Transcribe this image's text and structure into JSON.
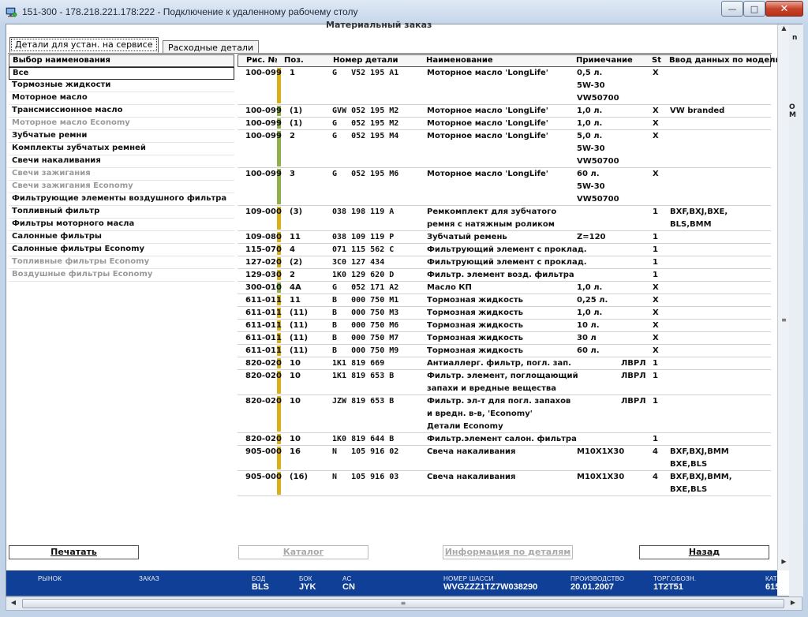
{
  "window": {
    "title": "151-300 - 178.218.221.178:222 - Подключение к удаленному рабочему столу",
    "header_cut": "Материальный заказ"
  },
  "tabs": [
    {
      "label": "Детали для устан. на сервисе"
    },
    {
      "label": "Расходные детали"
    }
  ],
  "list": {
    "header": "Выбор наименования",
    "items": [
      {
        "label": "Все",
        "state": "selected"
      },
      {
        "label": "Тормозные жидкости",
        "state": "normal"
      },
      {
        "label": "Моторное масло",
        "state": "normal"
      },
      {
        "label": "Трансмиссионное масло",
        "state": "normal"
      },
      {
        "label": "Моторное масло Economy",
        "state": "dim"
      },
      {
        "label": "Зубчатые ремни",
        "state": "normal"
      },
      {
        "label": "Комплекты зубчатых ремней",
        "state": "normal"
      },
      {
        "label": "Свечи накаливания",
        "state": "normal"
      },
      {
        "label": "Свечи зажигания",
        "state": "dim"
      },
      {
        "label": "Свечи зажигания Economy",
        "state": "dim"
      },
      {
        "label": "Фильтрующие элементы воздушного фильтра",
        "state": "normal"
      },
      {
        "label": "Топливный фильтр",
        "state": "normal"
      },
      {
        "label": "Фильтры моторного масла",
        "state": "normal"
      },
      {
        "label": "Салонные фильтры",
        "state": "normal"
      },
      {
        "label": "Салонные фильтры Economy",
        "state": "normal"
      },
      {
        "label": "Топливные фильтры Economy",
        "state": "dim"
      },
      {
        "label": "Воздушные фильтры Economy",
        "state": "dim"
      }
    ]
  },
  "table": {
    "columns": [
      "Рис. №",
      "Поз.",
      "Номер детали",
      "Наименование",
      "Примечание",
      "St",
      "Ввод данных по модели"
    ],
    "bar_colors": {
      "yellow": "#d9b01a",
      "green": "#8fb04a"
    },
    "rows": [
      {
        "fig": "100-099",
        "pos": "1",
        "part": "G   V52 195 A1",
        "name": [
          "Моторное масло 'LongLife'"
        ],
        "note": [
          "0,5 л.",
          "5W-30",
          "VW50700"
        ],
        "st": "X",
        "model": [],
        "lines": 3,
        "bar": "yellow"
      },
      {
        "fig": "100-099",
        "pos": "(1)",
        "part": "GVW 052 195 M2",
        "name": [
          "Моторное масло 'LongLife'"
        ],
        "note": [
          "1,0 л."
        ],
        "st": "X",
        "model": [
          "VW branded"
        ],
        "lines": 1,
        "bar": "green"
      },
      {
        "fig": "100-099",
        "pos": "(1)",
        "part": "G   052 195 M2",
        "name": [
          "Моторное масло 'LongLife'"
        ],
        "note": [
          "1,0 л."
        ],
        "st": "X",
        "model": [],
        "lines": 1,
        "bar": "green"
      },
      {
        "fig": "100-099",
        "pos": "2",
        "part": "G   052 195 M4",
        "name": [
          "Моторное масло 'LongLife'"
        ],
        "note": [
          "5,0 л.",
          "5W-30",
          "VW50700"
        ],
        "st": "X",
        "model": [],
        "lines": 3,
        "bar": "green"
      },
      {
        "fig": "100-099",
        "pos": "3",
        "part": "G   052 195 M6",
        "name": [
          "Моторное масло 'LongLife'"
        ],
        "note": [
          "60 л.",
          "5W-30",
          "VW50700"
        ],
        "st": "X",
        "model": [],
        "lines": 3,
        "bar": "green"
      },
      {
        "fig": "109-000",
        "pos": "(3)",
        "part": "038 198 119 A",
        "name": [
          "Ремкомплект для зубчатого",
          "ремня с натяжным роликом"
        ],
        "note": [],
        "st": "1",
        "model": [
          "BXF,BXJ,BXE,",
          "BLS,BMM"
        ],
        "lines": 2,
        "bar": "yellow"
      },
      {
        "fig": "109-080",
        "pos": "11",
        "part": "038 109 119 P",
        "name": [
          "Зубчатый ремень"
        ],
        "note": [
          "Z=120"
        ],
        "st": "1",
        "model": [],
        "lines": 1,
        "bar": "yellow"
      },
      {
        "fig": "115-070",
        "pos": "4",
        "part": "071 115 562 C",
        "name": [
          "Фильтрующий элемент с проклад."
        ],
        "note": [],
        "st": "1",
        "model": [],
        "lines": 1,
        "bar": "yellow"
      },
      {
        "fig": "127-020",
        "pos": "(2)",
        "part": "3C0 127 434",
        "name": [
          "Фильтрующий элемент с проклад."
        ],
        "note": [],
        "st": "1",
        "model": [],
        "lines": 1,
        "bar": "yellow"
      },
      {
        "fig": "129-030",
        "pos": "2",
        "part": "1K0 129 620 D",
        "name": [
          "Фильтр. элемент возд. фильтра"
        ],
        "note": [],
        "st": "1",
        "model": [],
        "lines": 1,
        "bar": "yellow"
      },
      {
        "fig": "300-010",
        "pos": "4A",
        "part": "G   052 171 A2",
        "name": [
          "Масло КП"
        ],
        "note": [
          "1,0 л."
        ],
        "st": "X",
        "model": [],
        "lines": 1,
        "bar": "green"
      },
      {
        "fig": "611-011",
        "pos": "11",
        "part": "B   000 750 M1",
        "name": [
          "Тормозная жидкость"
        ],
        "note": [
          "0,25 л."
        ],
        "st": "X",
        "model": [],
        "lines": 1,
        "bar": "yellow"
      },
      {
        "fig": "611-011",
        "pos": "(11)",
        "part": "B   000 750 M3",
        "name": [
          "Тормозная жидкость"
        ],
        "note": [
          "1,0 л."
        ],
        "st": "X",
        "model": [],
        "lines": 1,
        "bar": "yellow"
      },
      {
        "fig": "611-011",
        "pos": "(11)",
        "part": "B   000 750 M6",
        "name": [
          "Тормозная жидкость"
        ],
        "note": [
          "10 л."
        ],
        "st": "X",
        "model": [],
        "lines": 1,
        "bar": "yellow"
      },
      {
        "fig": "611-011",
        "pos": "(11)",
        "part": "B   000 750 M7",
        "name": [
          "Тормозная жидкость"
        ],
        "note": [
          "30 л"
        ],
        "st": "X",
        "model": [],
        "lines": 1,
        "bar": "yellow"
      },
      {
        "fig": "611-011",
        "pos": "(11)",
        "part": "B   000 750 M9",
        "name": [
          "Тормозная жидкость"
        ],
        "note": [
          "60 л."
        ],
        "st": "X",
        "model": [],
        "lines": 1,
        "bar": "yellow"
      },
      {
        "fig": "820-020",
        "pos": "10",
        "part": "1K1 819 669",
        "name": [
          "Антиаллерг. фильтр, погл. зап."
        ],
        "note": [
          "ЛВРЛ"
        ],
        "st": "1",
        "model": [],
        "lines": 1,
        "bar": "yellow",
        "note_right": true
      },
      {
        "fig": "820-020",
        "pos": "10",
        "part": "1K1 819 653 B",
        "name": [
          "Фильтр. элемент, поглощающий",
          "запахи и вредные вещества"
        ],
        "note": [
          "ЛВРЛ"
        ],
        "st": "1",
        "model": [],
        "lines": 2,
        "bar": "yellow",
        "note_right": true
      },
      {
        "fig": "820-020",
        "pos": "10",
        "part": "JZW 819 653 B",
        "name": [
          "Фильтр. эл-т для погл. запахов",
          "и вредн. в-в, 'Economy'",
          "Детали Economy"
        ],
        "note": [
          "ЛВРЛ"
        ],
        "st": "1",
        "model": [],
        "lines": 3,
        "bar": "yellow",
        "note_right": true
      },
      {
        "fig": "820-020",
        "pos": "10",
        "part": "1K0 819 644 B",
        "name": [
          "Фильтр.элемент салон. фильтра"
        ],
        "note": [],
        "st": "1",
        "model": [],
        "lines": 1,
        "bar": "yellow"
      },
      {
        "fig": "905-000",
        "pos": "16",
        "part": "N   105 916 02",
        "name": [
          "Свеча накаливания"
        ],
        "note": [
          "M10X1X30"
        ],
        "st": "4",
        "model": [
          "BXF,BXJ,BMM",
          "BXE,BLS"
        ],
        "lines": 2,
        "bar": "yellow"
      },
      {
        "fig": "905-000",
        "pos": "(16)",
        "part": "N   105 916 03",
        "name": [
          "Свеча накаливания"
        ],
        "note": [
          "M10X1X30"
        ],
        "st": "4",
        "model": [
          "BXF,BXJ,BMM,",
          "BXE,BLS"
        ],
        "lines": 2,
        "bar": "yellow"
      }
    ]
  },
  "buttons": {
    "print": "Печатать",
    "catalog": "Каталог",
    "info": "Информация по деталям",
    "back": "Назад"
  },
  "status": {
    "market_label": "РЫНОК",
    "order_label": "ЗАКАЗ",
    "bod_label": "БОД",
    "bod_value": "BLS",
    "bok_label": "БОК",
    "bok_value": "JYK",
    "ac_label": "AC",
    "ac_value": "CN",
    "chassis_label": "НОМЕР ШАССИ",
    "chassis_value": "WVGZZZ1TZ7W038290",
    "prod_label": "ПРОИЗВОДСТВО",
    "prod_value": "20.01.2007",
    "trade_label": "ТОРГ.ОБОЗН.",
    "trade_value": "1T2T51",
    "cat_label": "КАТ",
    "cat_value": "615"
  },
  "side_fragments": [
    "n",
    "O M"
  ]
}
